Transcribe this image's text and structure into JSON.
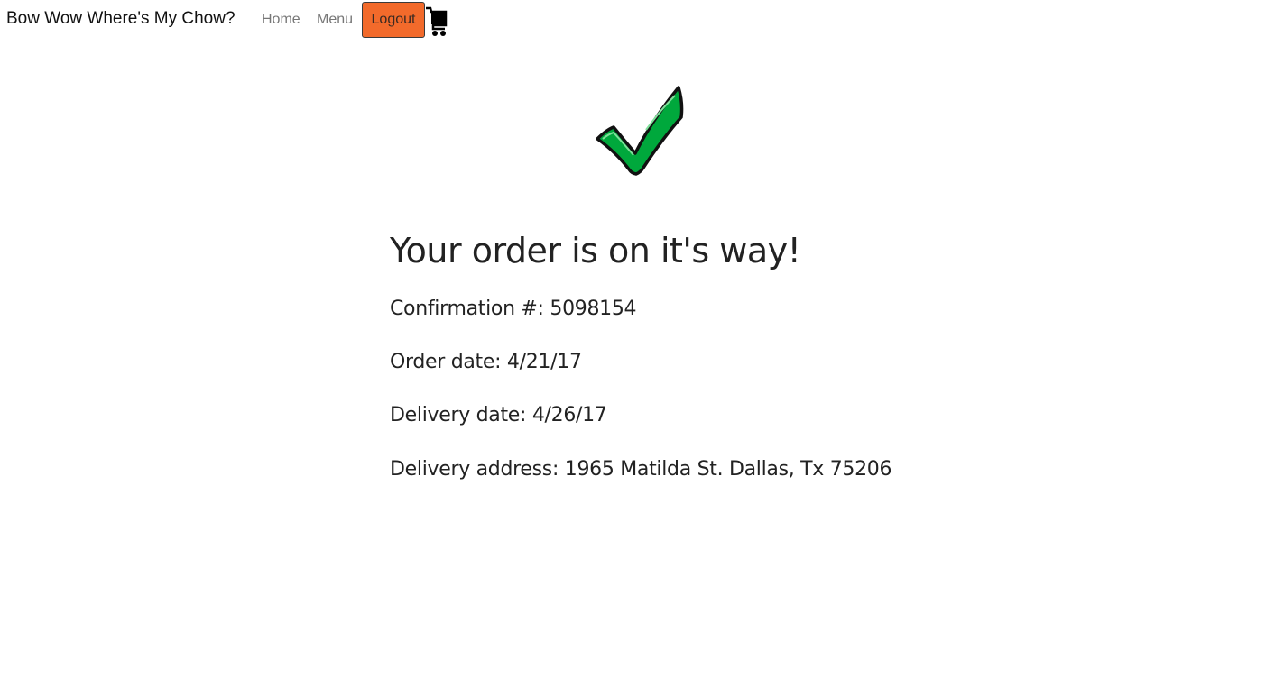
{
  "navbar": {
    "brand": "Bow Wow Where's My Chow?",
    "links": [
      {
        "label": "Home"
      },
      {
        "label": "Menu"
      }
    ],
    "logout_label": "Logout",
    "cart_icon": "shopping-cart-icon"
  },
  "confirmation": {
    "icon": "green-checkmark-icon",
    "title": "Your order is on it's way!",
    "lines": [
      "Confirmation #: 5098154",
      "Order date: 4/21/17",
      "Delivery date: 4/26/17",
      "Delivery address: 1965 Matilda St. Dallas, Tx 75206"
    ]
  },
  "colors": {
    "logout_bg": "#f26a2b",
    "check_green": "#00a83c",
    "nav_link": "#777777"
  }
}
